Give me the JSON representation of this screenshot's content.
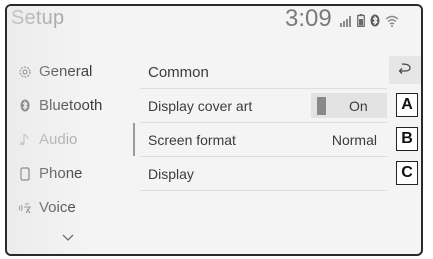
{
  "header": {
    "title": "Setup",
    "clock": "3:09"
  },
  "status_icons": [
    "signal-bars-icon",
    "battery-icon",
    "bluetooth-icon",
    "wifi-icon"
  ],
  "sidebar": {
    "items": [
      {
        "label": "General",
        "icon": "gear-icon"
      },
      {
        "label": "Bluetooth",
        "icon": "bluetooth-icon"
      },
      {
        "label": "Audio",
        "icon": "music-note-icon"
      },
      {
        "label": "Phone",
        "icon": "phone-icon"
      },
      {
        "label": "Voice",
        "icon": "voice-icon"
      }
    ],
    "active_item": "Audio",
    "more_icon": "chevron-down-icon"
  },
  "main": {
    "section_title": "Common",
    "back_icon": "back-arrow-icon",
    "rows": [
      {
        "label": "Display cover art",
        "value": "On",
        "control": "toggle"
      },
      {
        "label": "Screen format",
        "value": "Normal"
      },
      {
        "label": "Display",
        "value": ""
      }
    ]
  },
  "callouts": [
    "A",
    "B",
    "C"
  ]
}
